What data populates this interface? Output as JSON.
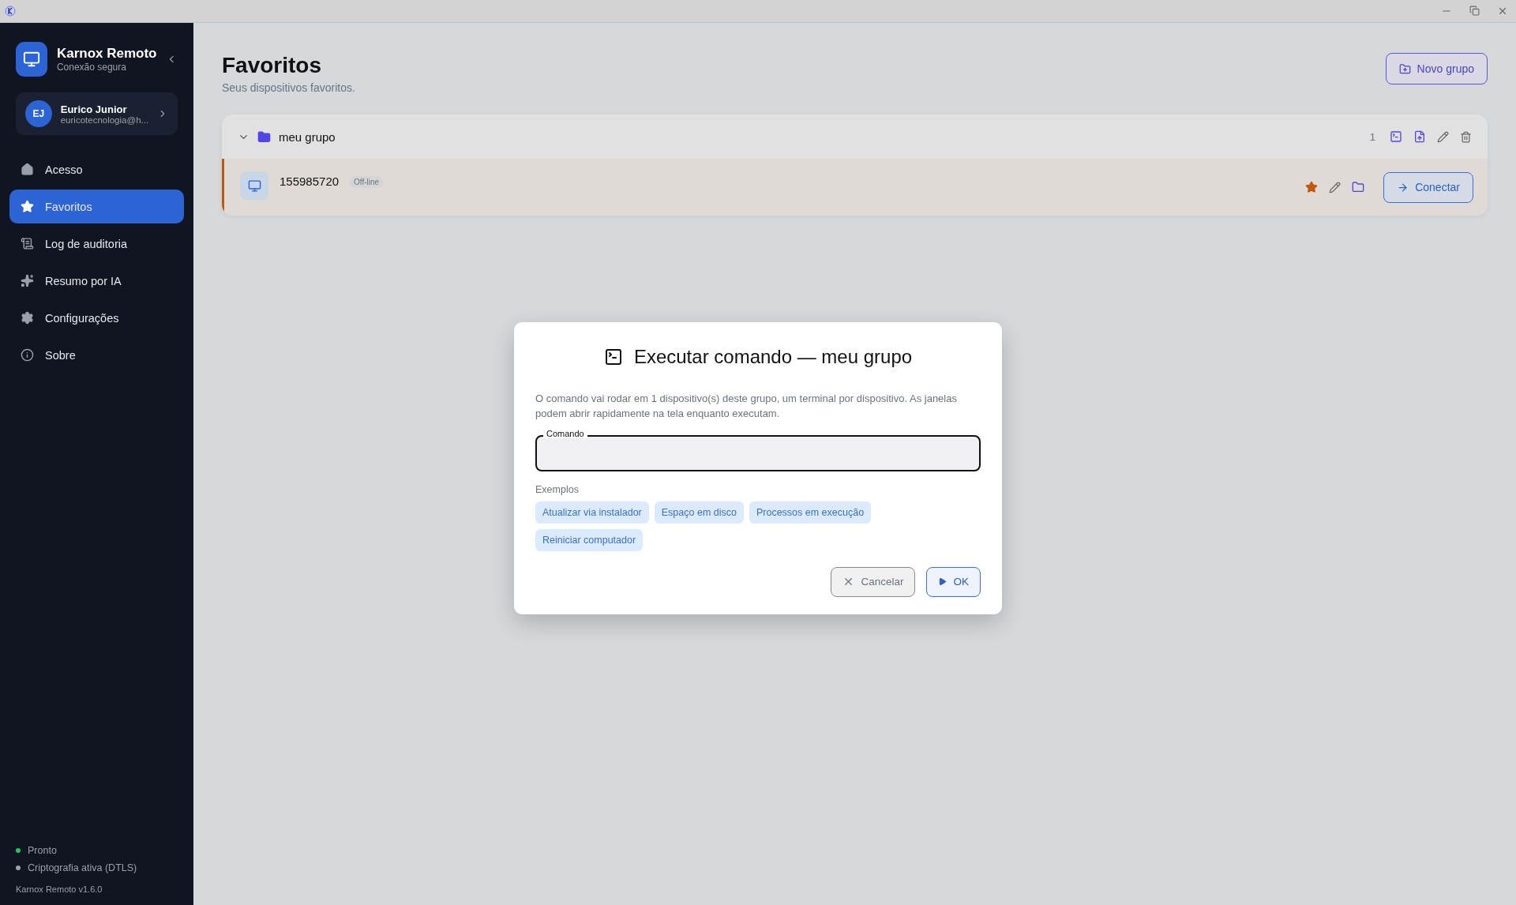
{
  "brand": {
    "name": "Karnox Remoto",
    "subtitle": "Conexão segura"
  },
  "user": {
    "initials": "EJ",
    "name": "Eurico Junior",
    "email": "euricotecnologia@h..."
  },
  "nav": [
    {
      "kind": "home",
      "label": "Acesso",
      "selected": false
    },
    {
      "kind": "star",
      "label": "Favoritos",
      "selected": true
    },
    {
      "kind": "log",
      "label": "Log de auditoria",
      "selected": false
    },
    {
      "kind": "sparkles",
      "label": "Resumo por IA",
      "selected": false
    },
    {
      "kind": "gear",
      "label": "Configurações",
      "selected": false
    },
    {
      "kind": "info",
      "label": "Sobre",
      "selected": false
    }
  ],
  "status": [
    {
      "label": "Pronto",
      "color": "#22c55e"
    },
    {
      "label": "Criptografia ativa (DTLS)",
      "color": "#9ca3af"
    }
  ],
  "version": "Karnox Remoto v1.6.0",
  "page": {
    "title": "Favoritos",
    "subtitle": "Seus dispositivos favoritos.",
    "new_group_button": "Novo grupo"
  },
  "group": {
    "name": "meu grupo",
    "expanded": true,
    "count": "1",
    "devices": [
      {
        "id": "155985720",
        "status": "Off-line",
        "favorite": true,
        "connect_button": "Conectar"
      }
    ]
  },
  "dialog": {
    "title": "Executar comando — meu grupo",
    "message": "O comando vai rodar em 1 dispositivo(s) deste grupo, um terminal por dispositivo. As janelas podem abrir rapidamente na tela enquanto executam.",
    "field_label": "Comando",
    "examples_label": "Exemplos",
    "examples": [
      "Atualizar via instalador",
      "Espaço em disco",
      "Processos em execução",
      "Reiniciar computador"
    ],
    "cancel_button": "Cancelar",
    "ok_button": "OK"
  }
}
